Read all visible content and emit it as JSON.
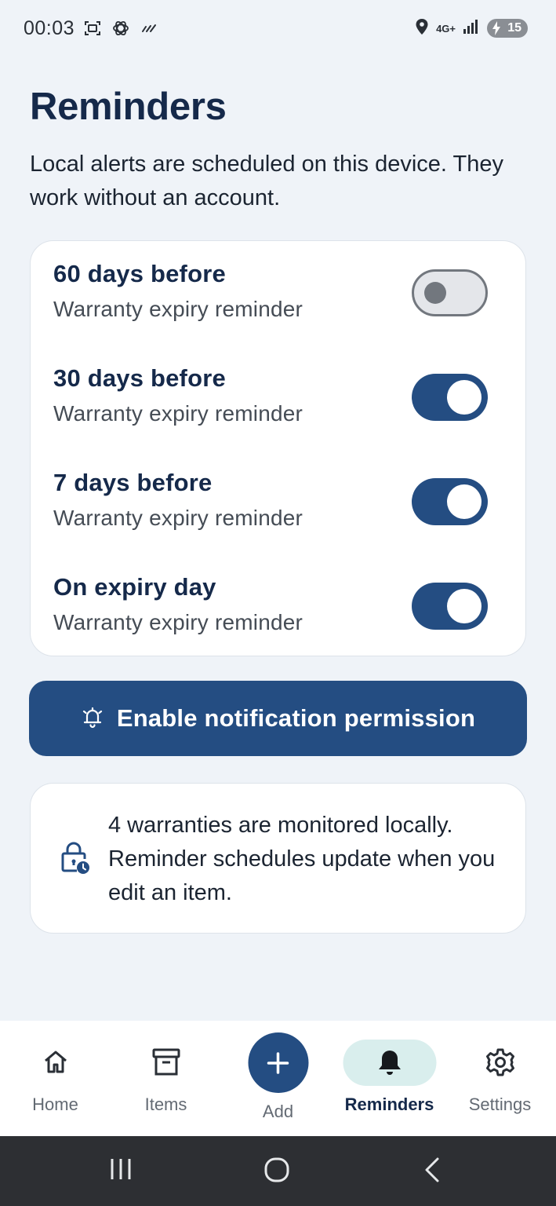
{
  "status_bar": {
    "time": "00:03",
    "network": "4G+",
    "battery": "15",
    "icons": [
      "screenshot-icon",
      "openai-icon",
      "wifi-off-icon",
      "location-icon",
      "signal-icon",
      "battery-icon"
    ]
  },
  "header": {
    "title": "Reminders",
    "description": "Local alerts are scheduled on this device. They work without an account."
  },
  "reminders": [
    {
      "title": "60 days before",
      "subtitle": "Warranty expiry reminder",
      "enabled": false
    },
    {
      "title": "30 days before",
      "subtitle": "Warranty expiry reminder",
      "enabled": true
    },
    {
      "title": "7 days before",
      "subtitle": "Warranty expiry reminder",
      "enabled": true
    },
    {
      "title": "On expiry day",
      "subtitle": "Warranty expiry reminder",
      "enabled": true
    }
  ],
  "enable_button": {
    "label": "Enable notification permission",
    "icon": "alarm-bell-icon"
  },
  "info": {
    "icon": "lock-clock-icon",
    "text": "4 warranties are monitored locally. Reminder schedules update when you edit an item."
  },
  "bottom_nav": {
    "items": [
      {
        "label": "Home",
        "icon": "home-icon"
      },
      {
        "label": "Items",
        "icon": "archive-icon"
      },
      {
        "label": "Add",
        "icon": "plus-icon"
      },
      {
        "label": "Reminders",
        "icon": "bell-icon",
        "active": true
      },
      {
        "label": "Settings",
        "icon": "gear-icon"
      }
    ]
  },
  "colors": {
    "primary": "#244d82",
    "title": "#15294a",
    "background": "#eff3f8",
    "active_pill": "#d9eeed"
  }
}
